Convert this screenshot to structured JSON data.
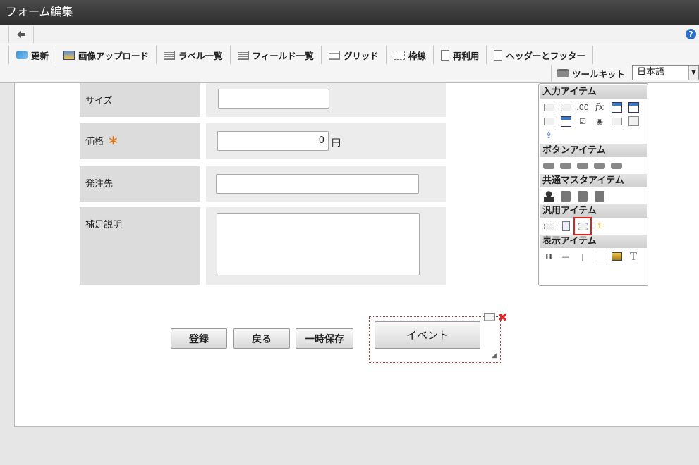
{
  "window": {
    "title": "フォーム編集"
  },
  "toolbar": {
    "items": [
      {
        "label": "更新",
        "icon": "refresh-icon"
      },
      {
        "label": "画像アップロード",
        "icon": "image-upload-icon"
      },
      {
        "label": "ラベル一覧",
        "icon": "label-list-icon"
      },
      {
        "label": "フィールド一覧",
        "icon": "field-list-icon"
      },
      {
        "label": "グリッド",
        "icon": "grid-icon"
      },
      {
        "label": "枠線",
        "icon": "border-icon"
      },
      {
        "label": "再利用",
        "icon": "reuse-icon"
      },
      {
        "label": "ヘッダーとフッター",
        "icon": "header-footer-icon"
      }
    ],
    "toolkit_label": "ツールキット",
    "language": "日本語"
  },
  "form": {
    "fields": [
      {
        "label": "サイズ",
        "value": "",
        "required": false
      },
      {
        "label": "価格",
        "value": "0",
        "unit": "円",
        "required": true,
        "required_mark": "＊"
      },
      {
        "label": "発注先",
        "value": "",
        "required": false
      },
      {
        "label": "補足説明",
        "value": "",
        "required": false
      }
    ],
    "buttons": {
      "register": "登録",
      "back": "戻る",
      "temp_save": "一時保存",
      "event": "イベント"
    }
  },
  "palette": {
    "sections": [
      {
        "title": "入力アイテム"
      },
      {
        "title": "ボタンアイテム"
      },
      {
        "title": "共通マスタアイテム"
      },
      {
        "title": "汎用アイテム"
      },
      {
        "title": "表示アイテム"
      }
    ]
  },
  "colors": {
    "title_bar": "#2e2e2e",
    "required": "#e2720a",
    "selection": "#dd2222"
  }
}
